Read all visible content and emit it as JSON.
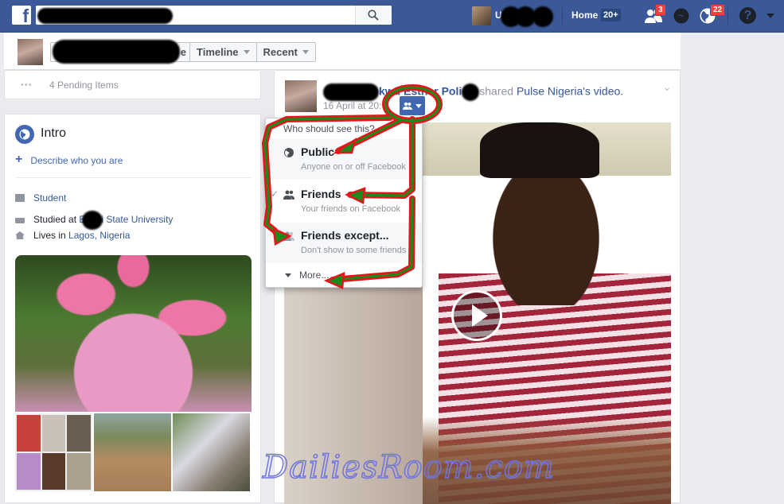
{
  "topbar": {
    "logo": "f",
    "search_placeholder": "",
    "search_icon": "search-icon",
    "user_initial": "U",
    "home_label": "Home",
    "home_count": "20+",
    "friend_requests_badge": "3",
    "notifications_badge": "22",
    "help_glyph": "?",
    "brand_color": "#3b5998"
  },
  "profile_strip": {
    "name_tail": "e",
    "tabs": [
      {
        "label": "Timeline"
      },
      {
        "label": "Recent"
      }
    ]
  },
  "pending": {
    "dots": "•••",
    "label": "4 Pending Items"
  },
  "intro": {
    "title": "Intro",
    "describe_plus": "+",
    "describe_label": "Describe who you are",
    "work": "Student",
    "studied_prefix": "Studied at",
    "studied_school_prefix": "E",
    "studied_school_suffix": "yi State University",
    "lives_prefix": "Lives in",
    "lives_place": "Lagos, Nigeria"
  },
  "post": {
    "name_partial_1": "kwu Esther",
    "name_partial_2": "Poli",
    "action_text": "shared",
    "shared_from": "Pulse Nigeria",
    "shared_suffix": "'s video.",
    "timestamp": "16 April at 20:",
    "menu_chevron": "⌄"
  },
  "audience_menu": {
    "header": "Who should see this?",
    "options": [
      {
        "title": "Public",
        "subtitle": "Anyone on or off Facebook",
        "icon": "globe-icon",
        "selected": false
      },
      {
        "title": "Friends",
        "subtitle": "Your friends on Facebook",
        "icon": "friends-icon",
        "selected": true
      },
      {
        "title": "Friends except...",
        "subtitle": "Don't show to some friends",
        "icon": "friends-except-icon",
        "selected": false
      }
    ],
    "checkmark": "✓",
    "more_label": "More..."
  },
  "watermark": "DailiesRoom.com",
  "annotation_colors": {
    "outline": "#e8141a",
    "fill": "#1a8a1a"
  }
}
